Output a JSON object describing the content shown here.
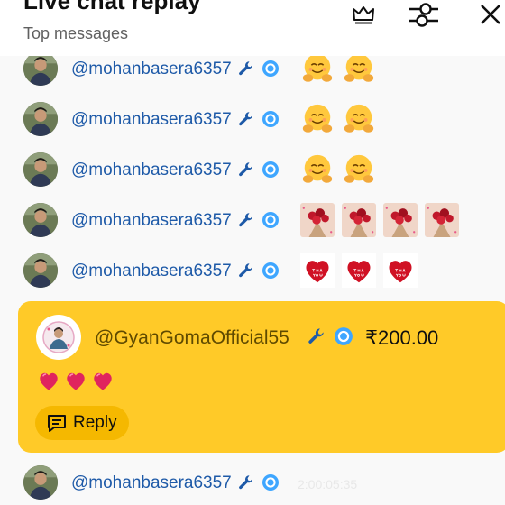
{
  "header": {
    "title": "Live chat replay",
    "subtitle": "Top messages",
    "icons": [
      "crown-icon",
      "filter-sliders-icon",
      "close-icon"
    ]
  },
  "messages": [
    {
      "username": "@mohanbasera6357",
      "badges": [
        "wrench-icon",
        "verified-icon"
      ],
      "emotes": [
        "hug-emoji",
        "hug-emoji"
      ]
    },
    {
      "username": "@mohanbasera6357",
      "badges": [
        "wrench-icon",
        "verified-icon"
      ],
      "emotes": [
        "hug-emoji",
        "hug-emoji"
      ]
    },
    {
      "username": "@mohanbasera6357",
      "badges": [
        "wrench-icon",
        "verified-icon"
      ],
      "emotes": [
        "hug-emoji",
        "hug-emoji"
      ]
    },
    {
      "username": "@mohanbasera6357",
      "badges": [
        "wrench-icon",
        "verified-icon"
      ],
      "emotes": [
        "rose-bouquet-sticker",
        "rose-bouquet-sticker",
        "rose-bouquet-sticker",
        "rose-bouquet-sticker"
      ]
    },
    {
      "username": "@mohanbasera6357",
      "badges": [
        "wrench-icon",
        "verified-icon"
      ],
      "emotes": [
        "thank-you-heart-sticker",
        "thank-you-heart-sticker",
        "thank-you-heart-sticker"
      ]
    }
  ],
  "superchat": {
    "username": "@GyanGomaOfficial55",
    "amount": "₹200.00",
    "message": "❤️❤️❤️",
    "reply_label": "Reply"
  },
  "last_message": {
    "username": "@mohanbasera6357",
    "time": "2:00:05:35"
  },
  "colors": {
    "superchat_bg": "#ffca28",
    "reply_bg": "#f5b800",
    "username": "#1e5aa8",
    "verified": "#3ea6ff"
  }
}
